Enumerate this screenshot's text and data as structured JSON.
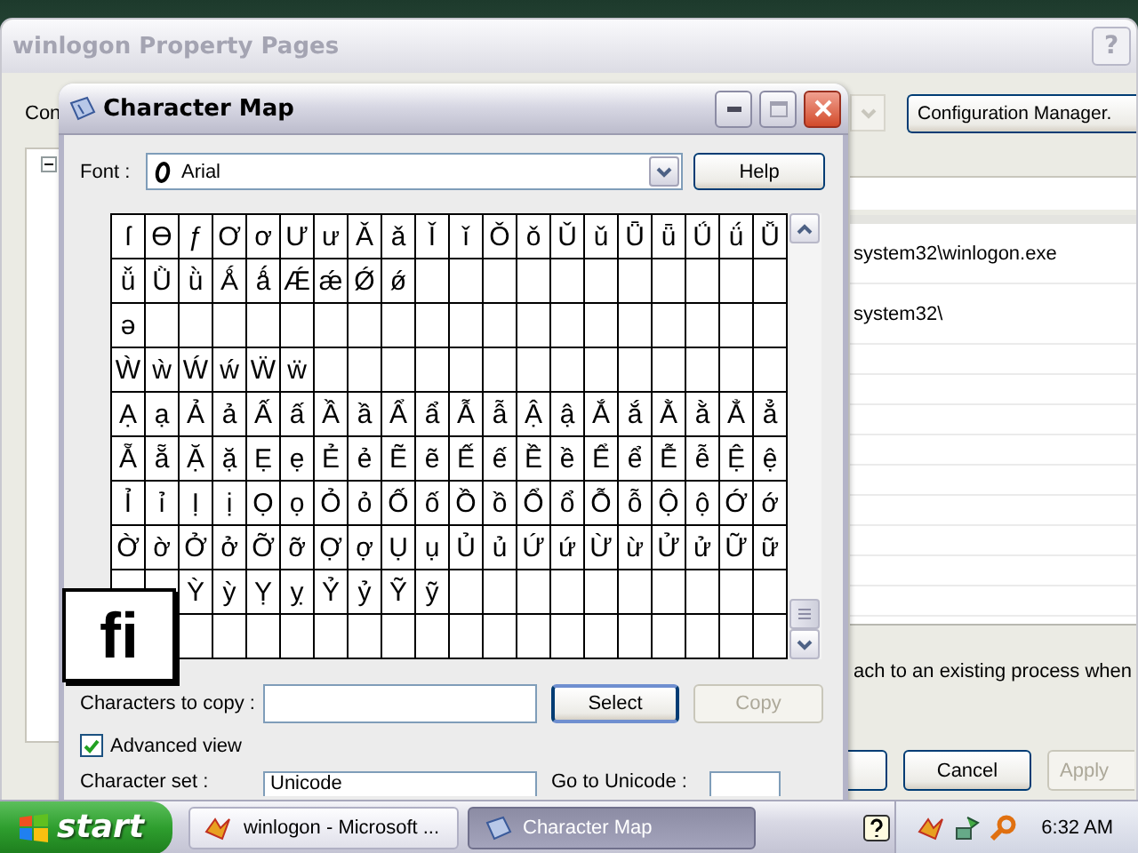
{
  "background_window": {
    "title": "winlogon Property Pages",
    "help_button": "?",
    "label": "Con",
    "configuration_button": "Configuration Manager.",
    "list_rows": [
      {
        "value": "system32\\winlogon.exe"
      },
      {
        "value": "system32\\"
      }
    ],
    "note": "ach to an existing process when",
    "buttons": [
      {
        "label": "Cancel",
        "disabled": false
      },
      {
        "label": "Apply",
        "disabled": true
      }
    ]
  },
  "charmap": {
    "title": "Character Map",
    "font_label": "Font :",
    "font_value": "Arial",
    "help_button": "Help",
    "grid": [
      [
        "ſ",
        "Ɵ",
        "ƒ",
        "Ơ",
        "ơ",
        "Ư",
        "ư",
        "Ǎ",
        "ǎ",
        "Ǐ",
        "ǐ",
        "Ǒ",
        "ǒ",
        "Ǔ",
        "ǔ",
        "Ǖ",
        "ǖ",
        "Ǘ",
        "ǘ",
        "Ǚ"
      ],
      [
        "ǚ",
        "Ǜ",
        "ǜ",
        "Ǻ",
        "ǻ",
        "Ǽ",
        "ǽ",
        "Ǿ",
        "ǿ"
      ],
      [
        "ə"
      ],
      [
        "Ẁ",
        "ẁ",
        "Ẃ",
        "ẃ",
        "Ẅ",
        "ẅ"
      ],
      [
        "Ạ",
        "ạ",
        "Ả",
        "ả",
        "Ấ",
        "ấ",
        "Ầ",
        "ầ",
        "Ẩ",
        "ẩ",
        "Ẫ",
        "ẫ",
        "Ậ",
        "ậ",
        "Ắ",
        "ắ",
        "Ằ",
        "ằ",
        "Ẳ",
        "ẳ"
      ],
      [
        "Ẵ",
        "ẵ",
        "Ặ",
        "ặ",
        "Ẹ",
        "ẹ",
        "Ẻ",
        "ẻ",
        "Ẽ",
        "ẽ",
        "Ế",
        "ế",
        "Ề",
        "ề",
        "Ể",
        "ể",
        "Ễ",
        "ễ",
        "Ệ",
        "ệ"
      ],
      [
        "Ỉ",
        "ỉ",
        "Ị",
        "ị",
        "Ọ",
        "ọ",
        "Ỏ",
        "ỏ",
        "Ố",
        "ố",
        "Ồ",
        "ồ",
        "Ổ",
        "ổ",
        "Ỗ",
        "ỗ",
        "Ộ",
        "ộ",
        "Ớ",
        "ớ"
      ],
      [
        "Ờ",
        "ờ",
        "Ở",
        "ở",
        "Ỡ",
        "ỡ",
        "Ợ",
        "ợ",
        "Ụ",
        "ụ",
        "Ủ",
        "ủ",
        "Ứ",
        "ứ",
        "Ừ",
        "ừ",
        "Ử",
        "ử",
        "Ữ",
        "ữ"
      ],
      [
        "Ỳ",
        "ỳ",
        "Ỵ",
        "ỵ",
        "Ỷ",
        "ỷ",
        "Ỹ",
        "ỹ"
      ]
    ],
    "magnifier": "fi",
    "copy_label": "Characters to copy :",
    "select_button": "Select",
    "copy_button": {
      "label": "Copy",
      "disabled": true
    },
    "advanced_view": {
      "label": "Advanced view",
      "checked": true
    },
    "charset_label": "Character set :",
    "charset_value": "Unicode",
    "goto_label": "Go to Unicode :"
  },
  "taskbar": {
    "start": "start",
    "tasks": [
      {
        "label": "winlogon - Microsoft ...",
        "selected": false
      },
      {
        "label": "Character Map",
        "selected": true
      }
    ],
    "clock": "6:32 AM"
  }
}
